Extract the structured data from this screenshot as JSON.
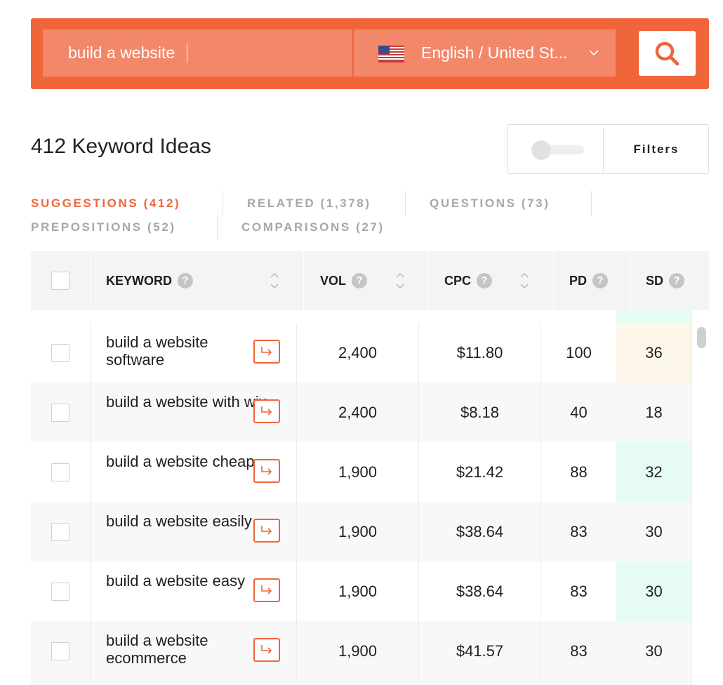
{
  "search": {
    "keyword_value": "build a website",
    "language_label": "English / United St...",
    "language_flag_icon": "us-flag-icon",
    "dropdown_icon": "chevron-down-icon",
    "search_icon": "search-icon"
  },
  "results": {
    "title": "412 Keyword Ideas",
    "filters_label": "Filters"
  },
  "tabs": [
    {
      "label": "SUGGESTIONS (412)",
      "active": true
    },
    {
      "label": "RELATED (1,378)",
      "active": false
    },
    {
      "label": "QUESTIONS (73)",
      "active": false
    },
    {
      "label": "PREPOSITIONS (52)",
      "active": false
    },
    {
      "label": "COMPARISONS (27)",
      "active": false
    }
  ],
  "table": {
    "columns": {
      "keyword": "KEYWORD",
      "vol": "VOL",
      "cpc": "CPC",
      "pd": "PD",
      "sd": "SD",
      "help_glyph": "?"
    },
    "rows": [
      {
        "keyword": "build a website software",
        "vol": "2,400",
        "cpc": "$11.80",
        "pd": "100",
        "sd": "36"
      },
      {
        "keyword": "build a website with wix",
        "vol": "2,400",
        "cpc": "$8.18",
        "pd": "40",
        "sd": "18"
      },
      {
        "keyword": "build a website cheap",
        "vol": "1,900",
        "cpc": "$21.42",
        "pd": "88",
        "sd": "32"
      },
      {
        "keyword": "build a website easily",
        "vol": "1,900",
        "cpc": "$38.64",
        "pd": "83",
        "sd": "30"
      },
      {
        "keyword": "build a website easy",
        "vol": "1,900",
        "cpc": "$38.64",
        "pd": "83",
        "sd": "30"
      },
      {
        "keyword": "build a website ecommerce",
        "vol": "1,900",
        "cpc": "$41.57",
        "pd": "83",
        "sd": "30"
      }
    ]
  },
  "colors": {
    "accent": "#f0653a",
    "sd_low": "#e6fcf2",
    "sd_medium": "#fdf7ea"
  }
}
